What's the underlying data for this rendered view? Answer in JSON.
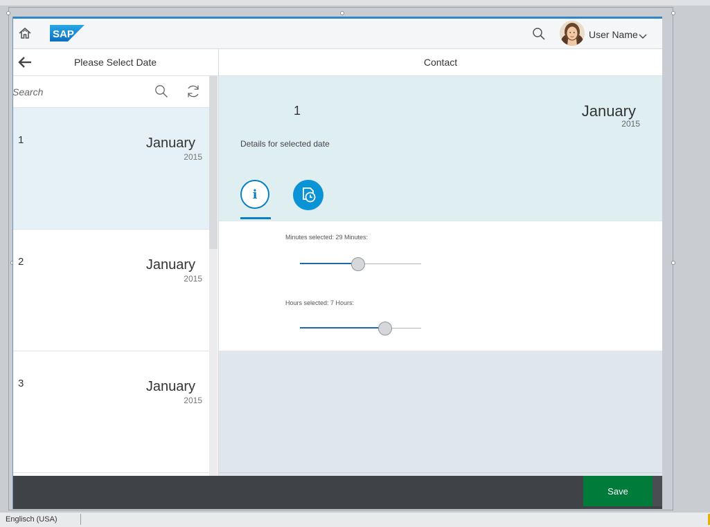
{
  "shell": {
    "icons": {
      "home": "home-icon",
      "logo": "sap-logo",
      "search": "search-icon",
      "chevron": "chevron-down-icon"
    },
    "logo_text": "SAP",
    "user_name": "User Name"
  },
  "master": {
    "title": "Please Select Date",
    "search_placeholder": "Search",
    "items": [
      {
        "number": "1",
        "month": "January",
        "year": "2015",
        "selected": true
      },
      {
        "number": "2",
        "month": "January",
        "year": "2015",
        "selected": false
      },
      {
        "number": "3",
        "month": "January",
        "year": "2015",
        "selected": false
      }
    ]
  },
  "detail": {
    "title": "Contact",
    "header": {
      "number": "1",
      "month": "January",
      "year": "2015",
      "description": "Details for selected date"
    },
    "tabs": [
      {
        "icon": "info-icon",
        "active": true
      },
      {
        "icon": "clock-document-icon",
        "active": false
      }
    ],
    "sliders": [
      {
        "label": "Minutes selected: 29 Minutes:",
        "value_fraction": 0.48
      },
      {
        "label": "Hours selected: 7 Hours:",
        "value_fraction": 0.7
      }
    ]
  },
  "footer": {
    "save_label": "Save"
  },
  "statusbar": {
    "language": "Englisch (USA)"
  },
  "colors": {
    "accent": "#0a7fc2",
    "save": "#007b39",
    "footer": "#3f4347",
    "selected_row": "#e5f0f7",
    "header_bg": "#deeef1"
  }
}
